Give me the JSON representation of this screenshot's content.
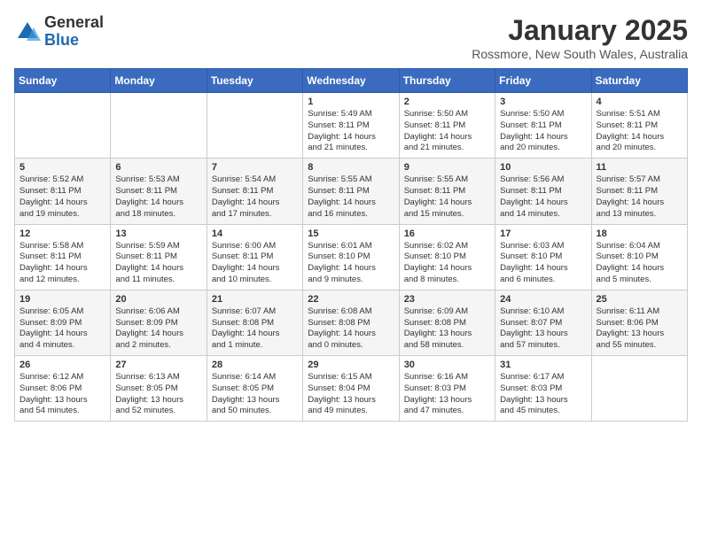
{
  "logo": {
    "general": "General",
    "blue": "Blue"
  },
  "title": {
    "month": "January 2025",
    "location": "Rossmore, New South Wales, Australia"
  },
  "headers": [
    "Sunday",
    "Monday",
    "Tuesday",
    "Wednesday",
    "Thursday",
    "Friday",
    "Saturday"
  ],
  "weeks": [
    [
      {
        "day": "",
        "info": ""
      },
      {
        "day": "",
        "info": ""
      },
      {
        "day": "",
        "info": ""
      },
      {
        "day": "1",
        "info": "Sunrise: 5:49 AM\nSunset: 8:11 PM\nDaylight: 14 hours\nand 21 minutes."
      },
      {
        "day": "2",
        "info": "Sunrise: 5:50 AM\nSunset: 8:11 PM\nDaylight: 14 hours\nand 21 minutes."
      },
      {
        "day": "3",
        "info": "Sunrise: 5:50 AM\nSunset: 8:11 PM\nDaylight: 14 hours\nand 20 minutes."
      },
      {
        "day": "4",
        "info": "Sunrise: 5:51 AM\nSunset: 8:11 PM\nDaylight: 14 hours\nand 20 minutes."
      }
    ],
    [
      {
        "day": "5",
        "info": "Sunrise: 5:52 AM\nSunset: 8:11 PM\nDaylight: 14 hours\nand 19 minutes."
      },
      {
        "day": "6",
        "info": "Sunrise: 5:53 AM\nSunset: 8:11 PM\nDaylight: 14 hours\nand 18 minutes."
      },
      {
        "day": "7",
        "info": "Sunrise: 5:54 AM\nSunset: 8:11 PM\nDaylight: 14 hours\nand 17 minutes."
      },
      {
        "day": "8",
        "info": "Sunrise: 5:55 AM\nSunset: 8:11 PM\nDaylight: 14 hours\nand 16 minutes."
      },
      {
        "day": "9",
        "info": "Sunrise: 5:55 AM\nSunset: 8:11 PM\nDaylight: 14 hours\nand 15 minutes."
      },
      {
        "day": "10",
        "info": "Sunrise: 5:56 AM\nSunset: 8:11 PM\nDaylight: 14 hours\nand 14 minutes."
      },
      {
        "day": "11",
        "info": "Sunrise: 5:57 AM\nSunset: 8:11 PM\nDaylight: 14 hours\nand 13 minutes."
      }
    ],
    [
      {
        "day": "12",
        "info": "Sunrise: 5:58 AM\nSunset: 8:11 PM\nDaylight: 14 hours\nand 12 minutes."
      },
      {
        "day": "13",
        "info": "Sunrise: 5:59 AM\nSunset: 8:11 PM\nDaylight: 14 hours\nand 11 minutes."
      },
      {
        "day": "14",
        "info": "Sunrise: 6:00 AM\nSunset: 8:11 PM\nDaylight: 14 hours\nand 10 minutes."
      },
      {
        "day": "15",
        "info": "Sunrise: 6:01 AM\nSunset: 8:10 PM\nDaylight: 14 hours\nand 9 minutes."
      },
      {
        "day": "16",
        "info": "Sunrise: 6:02 AM\nSunset: 8:10 PM\nDaylight: 14 hours\nand 8 minutes."
      },
      {
        "day": "17",
        "info": "Sunrise: 6:03 AM\nSunset: 8:10 PM\nDaylight: 14 hours\nand 6 minutes."
      },
      {
        "day": "18",
        "info": "Sunrise: 6:04 AM\nSunset: 8:10 PM\nDaylight: 14 hours\nand 5 minutes."
      }
    ],
    [
      {
        "day": "19",
        "info": "Sunrise: 6:05 AM\nSunset: 8:09 PM\nDaylight: 14 hours\nand 4 minutes."
      },
      {
        "day": "20",
        "info": "Sunrise: 6:06 AM\nSunset: 8:09 PM\nDaylight: 14 hours\nand 2 minutes."
      },
      {
        "day": "21",
        "info": "Sunrise: 6:07 AM\nSunset: 8:08 PM\nDaylight: 14 hours\nand 1 minute."
      },
      {
        "day": "22",
        "info": "Sunrise: 6:08 AM\nSunset: 8:08 PM\nDaylight: 14 hours\nand 0 minutes."
      },
      {
        "day": "23",
        "info": "Sunrise: 6:09 AM\nSunset: 8:08 PM\nDaylight: 13 hours\nand 58 minutes."
      },
      {
        "day": "24",
        "info": "Sunrise: 6:10 AM\nSunset: 8:07 PM\nDaylight: 13 hours\nand 57 minutes."
      },
      {
        "day": "25",
        "info": "Sunrise: 6:11 AM\nSunset: 8:06 PM\nDaylight: 13 hours\nand 55 minutes."
      }
    ],
    [
      {
        "day": "26",
        "info": "Sunrise: 6:12 AM\nSunset: 8:06 PM\nDaylight: 13 hours\nand 54 minutes."
      },
      {
        "day": "27",
        "info": "Sunrise: 6:13 AM\nSunset: 8:05 PM\nDaylight: 13 hours\nand 52 minutes."
      },
      {
        "day": "28",
        "info": "Sunrise: 6:14 AM\nSunset: 8:05 PM\nDaylight: 13 hours\nand 50 minutes."
      },
      {
        "day": "29",
        "info": "Sunrise: 6:15 AM\nSunset: 8:04 PM\nDaylight: 13 hours\nand 49 minutes."
      },
      {
        "day": "30",
        "info": "Sunrise: 6:16 AM\nSunset: 8:03 PM\nDaylight: 13 hours\nand 47 minutes."
      },
      {
        "day": "31",
        "info": "Sunrise: 6:17 AM\nSunset: 8:03 PM\nDaylight: 13 hours\nand 45 minutes."
      },
      {
        "day": "",
        "info": ""
      }
    ]
  ]
}
